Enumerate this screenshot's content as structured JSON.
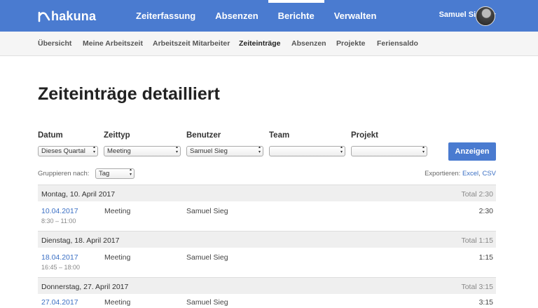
{
  "header": {
    "logo_text": "hakuna",
    "nav": [
      "Zeiterfassung",
      "Absenzen",
      "Berichte",
      "Verwalten"
    ],
    "active_nav": "Berichte",
    "user_name": "Samuel Sieg"
  },
  "subnav": {
    "items": [
      "Übersicht",
      "Meine Arbeitszeit",
      "Arbeitszeit Mitarbeiter",
      "Zeiteinträge",
      "Absenzen",
      "Projekte",
      "Feriensaldo"
    ],
    "active": "Zeiteinträge"
  },
  "page_title": "Zeiteinträge detailliert",
  "filters": {
    "datum": {
      "label": "Datum",
      "value": "Dieses Quartal"
    },
    "zeittyp": {
      "label": "Zeittyp",
      "value": "Meeting"
    },
    "benutzer": {
      "label": "Benutzer",
      "value": "Samuel Sieg"
    },
    "team": {
      "label": "Team",
      "value": ""
    },
    "projekt": {
      "label": "Projekt",
      "value": ""
    },
    "submit_label": "Anzeigen"
  },
  "grouping": {
    "label": "Gruppieren nach:",
    "value": "Tag"
  },
  "export": {
    "label": "Exportieren:",
    "excel": "Excel",
    "separator": ",",
    "csv": "CSV"
  },
  "days": [
    {
      "heading": "Montag, 10. April 2017",
      "total": "Total 2:30",
      "entries": [
        {
          "date": "10.04.2017",
          "time": "8:30 – 11:00",
          "type": "Meeting",
          "user": "Samuel Sieg",
          "duration": "2:30"
        }
      ]
    },
    {
      "heading": "Dienstag, 18. April 2017",
      "total": "Total 1:15",
      "entries": [
        {
          "date": "18.04.2017",
          "time": "16:45 – 18:00",
          "type": "Meeting",
          "user": "Samuel Sieg",
          "duration": "1:15"
        }
      ]
    },
    {
      "heading": "Donnerstag, 27. April 2017",
      "total": "Total 3:15",
      "entries": [
        {
          "date": "27.04.2017",
          "time": "",
          "type": "Meeting",
          "user": "Samuel Sieg",
          "duration": "3:15"
        }
      ]
    }
  ],
  "colors": {
    "primary": "#4a7bd0",
    "link": "#3a6fc4"
  }
}
